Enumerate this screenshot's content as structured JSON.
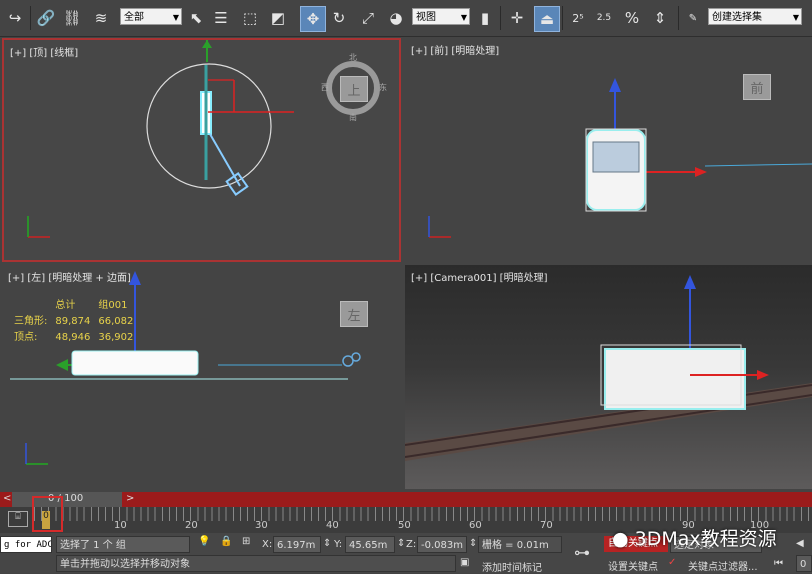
{
  "toolbar": {
    "selection_filter": "全部",
    "ref_coord": "视图",
    "named_selection": "创建选择集",
    "snap_angle": "2.5",
    "snap_percent": "%"
  },
  "viewports": {
    "top": {
      "label": "[+] [顶] [线框]",
      "cube": "上",
      "compass": [
        "北",
        "西",
        "东",
        "南"
      ]
    },
    "front": {
      "label": "[+] [前] [明暗处理]",
      "cube": "前"
    },
    "left": {
      "label": "[+] [左] [明暗处理 + 边面]",
      "cube": "左"
    },
    "camera": {
      "label": "[+] [Camera001] [明暗处理]"
    }
  },
  "stats": {
    "header": [
      "总计",
      "组001"
    ],
    "rows": [
      {
        "label": "三角形:",
        "total": "89,874",
        "group": "66,082"
      },
      {
        "label": "顶点:",
        "total": "48,946",
        "group": "36,902"
      }
    ]
  },
  "timeline": {
    "frame_text": "0 / 100",
    "ticks": [
      "10",
      "20",
      "30",
      "40",
      "50",
      "60",
      "70",
      "90",
      "100"
    ],
    "key_frame": "0"
  },
  "status": {
    "maxscript_text": "g for ADC",
    "selection_msg": "选择了 1 个 组",
    "prompt_msg": "单击并拖动以选择并移动对象",
    "x_label": "X:",
    "x_value": "6.197m",
    "y_label": "Y:",
    "y_value": "45.65m",
    "z_label": "Z:",
    "z_value": "-0.083m",
    "grid": "栅格 = 0.01m",
    "add_time_tag": "添加时间标记",
    "auto_key": "自动关键点",
    "selected_obj": "选定对象",
    "set_key": "设置关键点",
    "key_filters": "关键点过滤器...",
    "frame_field": "0"
  },
  "watermark": "3DMax教程资源",
  "colors": {
    "accent_red": "#b72323",
    "active_blue": "#5a86b8",
    "stats_yellow": "#e8d34a"
  }
}
